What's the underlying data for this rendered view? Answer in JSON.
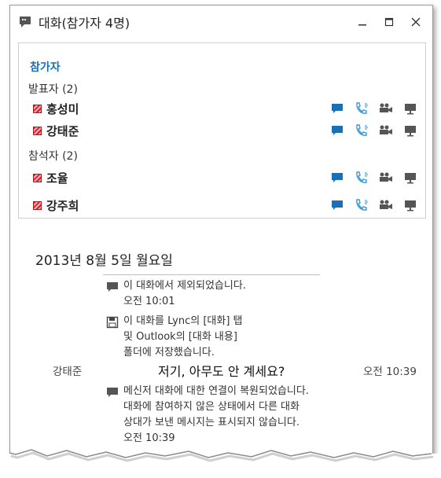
{
  "window": {
    "title": "대화(참가자 4명)"
  },
  "participants": {
    "header": "참가자",
    "presenters_label": "발표자 (2)",
    "attendees_label": "참석자 (2)",
    "presenters": [
      {
        "name": "홍성미"
      },
      {
        "name": "강태준"
      }
    ],
    "attendees": [
      {
        "name": "조율"
      },
      {
        "name": "강주희"
      }
    ]
  },
  "conversation": {
    "date": "2013년 8월 5일 월요일",
    "system_1": {
      "text": "이 대화에서 제외되었습니다.",
      "time": "오전 10:01"
    },
    "system_2": {
      "line1": "이 대화를 Lync의 [대화] 탭",
      "line2": "및 Outlook의 [대화 내용]",
      "line3": "폴더에 저장했습니다."
    },
    "message": {
      "sender": "강태준",
      "text": "저기, 아무도 안 계세요?",
      "time": "오전 10:39"
    },
    "system_3": {
      "line1": "메신저 대화에 대한 연결이 복원되었습니다.",
      "line2": "대화에 참여하지 않은 상태에서 다른 대화",
      "line3": "상대가 보낸 메시지는 표시되지 않습니다.",
      "time": "오전 10:39"
    }
  },
  "colors": {
    "accent": "#1a6fb5",
    "im_icon": "#1a6fb5",
    "call_icon": "#3a9ad9",
    "muted_icon": "#555555",
    "presence_busy": "#d0202a"
  }
}
